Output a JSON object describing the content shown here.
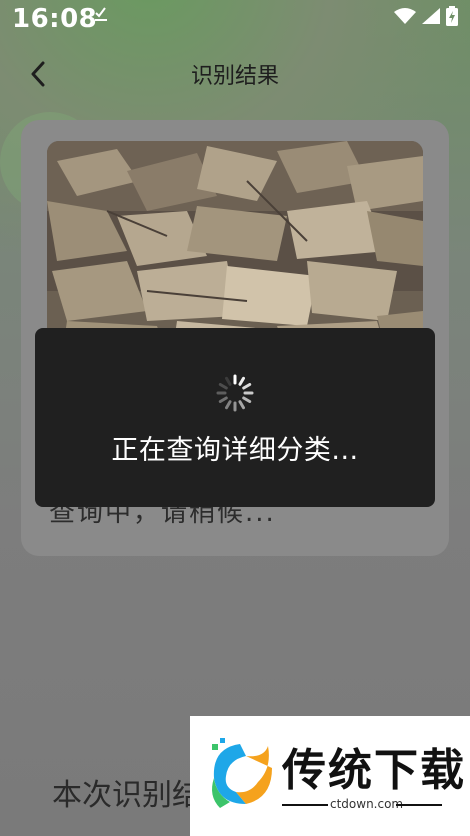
{
  "status_bar": {
    "time": "16:08"
  },
  "header": {
    "title": "识别结果"
  },
  "card": {
    "status_text": "查询中，请稍候..."
  },
  "loading_dialog": {
    "message": "正在查询详细分类..."
  },
  "footer": {
    "summary_text": "本次识别结果"
  },
  "watermark": {
    "brand": "传统下载",
    "domain": "ctdown.com"
  },
  "colors": {
    "dialog_bg": "#202020",
    "card_bg": "#8a8a8a",
    "header_green": "#6a9a60"
  }
}
